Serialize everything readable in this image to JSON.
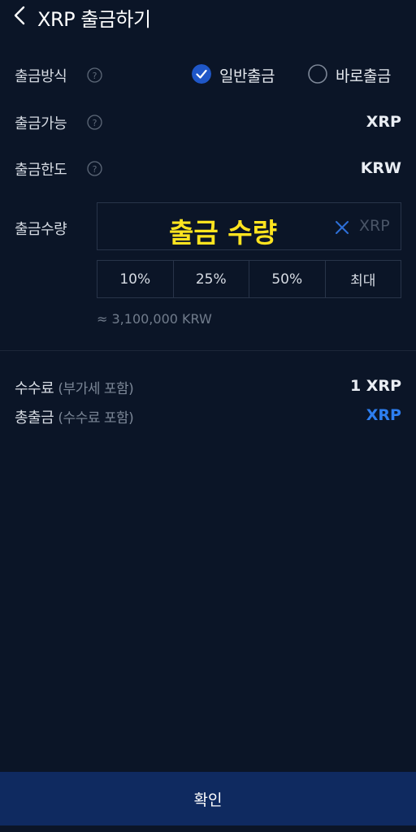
{
  "header": {
    "title": "XRP 출금하기"
  },
  "method": {
    "label": "출금방식",
    "option_general": "일반출금",
    "option_instant": "바로출금",
    "selected": "일반출금"
  },
  "available": {
    "label": "출금가능",
    "value": "XRP"
  },
  "limit": {
    "label": "출금한도",
    "value": "KRW"
  },
  "amount": {
    "label": "출금수량",
    "overlay_text": "출금 수량",
    "unit": "XRP"
  },
  "percent_buttons": [
    "10%",
    "25%",
    "50%",
    "최대"
  ],
  "approx_value": "≈ 3,100,000 KRW",
  "fee": {
    "label": "수수료",
    "sub": "(부가세 포함)",
    "value": "1 XRP"
  },
  "total": {
    "label": "총출금",
    "sub": "(수수료 포함)",
    "value": "XRP"
  },
  "confirm_label": "확인",
  "colors": {
    "background": "#0b1527",
    "accent": "#2d7ef0",
    "confirm_bg": "#0f2a60",
    "overlay_yellow": "#ffe41f"
  }
}
